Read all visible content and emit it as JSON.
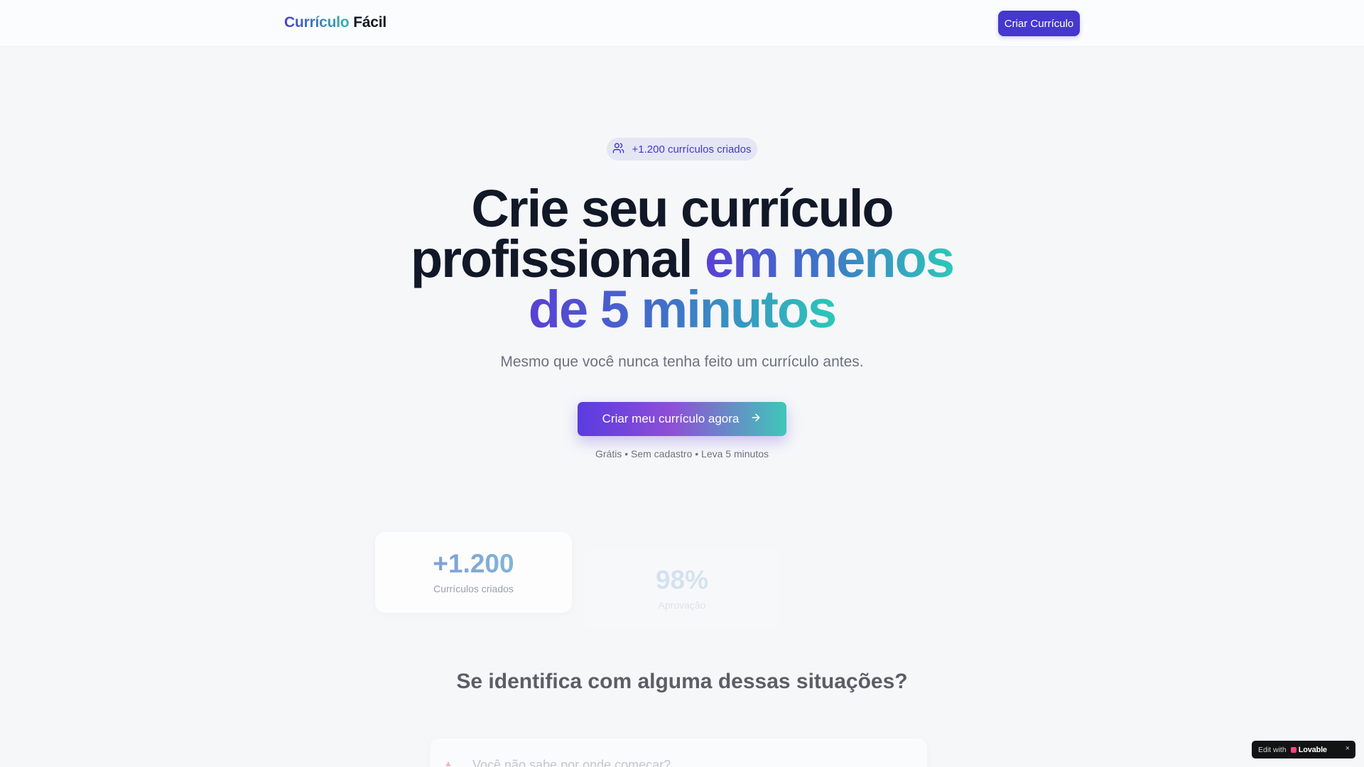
{
  "header": {
    "logo_part1": "Currículo",
    "logo_part2": "Fácil",
    "cta_label": "Criar Currículo"
  },
  "hero": {
    "badge_icon": "users-icon",
    "badge_text": "+1.200 currículos criados",
    "title_line1": "Crie seu currículo",
    "title_line2_plain": "profissional",
    "title_line2_grad": "em menos",
    "title_line3": "de 5 minutos",
    "subtitle": "Mesmo que você nunca tenha feito um currículo antes.",
    "cta_label": "Criar meu currículo agora",
    "cta_icon": "arrow-right-icon",
    "cta_note": "Grátis • Sem cadastro • Leva 5 minutos"
  },
  "stats": [
    {
      "value": "+1.200",
      "label": "Currículos criados"
    },
    {
      "value": "98%",
      "label": "Aprovação"
    }
  ],
  "situations": {
    "title": "Se identifica com alguma dessas situações?",
    "items": [
      {
        "text": "Você não sabe por onde começar?"
      }
    ]
  },
  "lovable_badge": {
    "prefix": "Edit with",
    "brand": "Lovable",
    "close": "×"
  },
  "colors": {
    "primary": "#4637cf",
    "accent_teal": "#2fb8b0",
    "background": "#f6f7f9"
  }
}
